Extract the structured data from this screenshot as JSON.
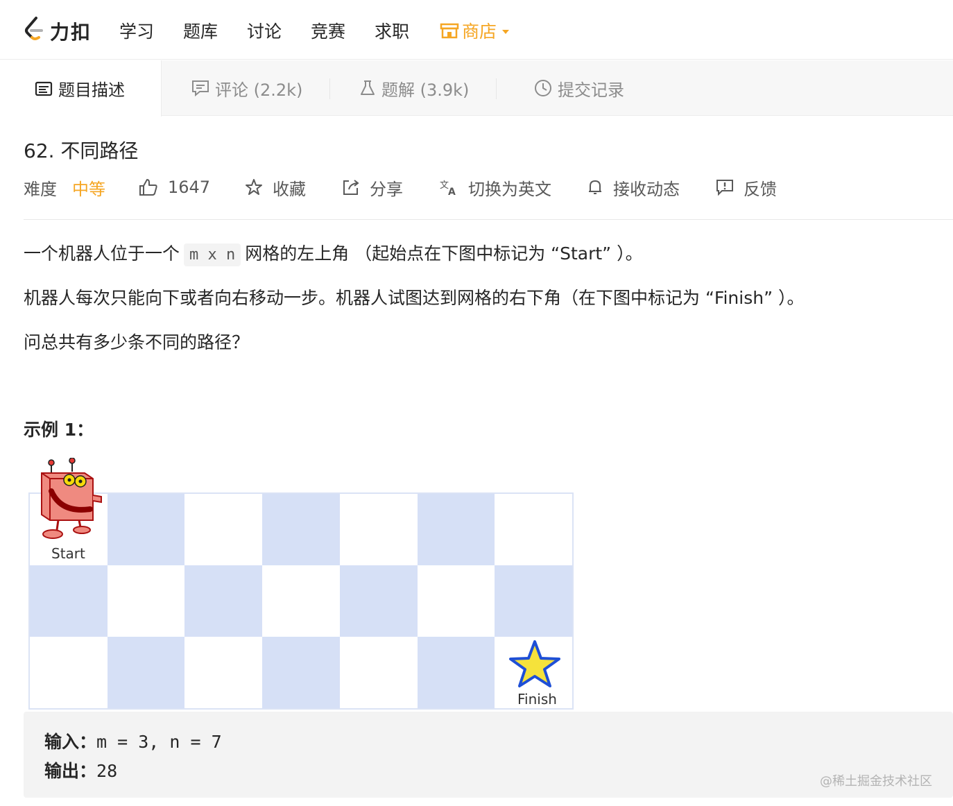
{
  "nav": {
    "logo_text": "力扣",
    "items": [
      "学习",
      "题库",
      "讨论",
      "竞赛",
      "求职"
    ],
    "store_label": "商店",
    "accent": "#f5a623"
  },
  "tabs": [
    {
      "label": "题目描述",
      "icon": "description-icon"
    },
    {
      "label": "评论 (2.2k)",
      "icon": "comment-icon"
    },
    {
      "label": "题解 (3.9k)",
      "icon": "flask-icon"
    },
    {
      "label": "提交记录",
      "icon": "clock-icon"
    }
  ],
  "problem": {
    "title": "62. 不同路径",
    "difficulty_label": "难度",
    "difficulty": "中等",
    "likes": "1647",
    "favorite": "收藏",
    "share": "分享",
    "translate": "切换为英文",
    "subscribe": "接收动态",
    "feedback": "反馈"
  },
  "description": {
    "p1_before": "一个机器人位于一个",
    "p1_code": "m x n",
    "p1_after": "网格的左上角 （起始点在下图中标记为 “Start” ）。",
    "p2": "机器人每次只能向下或者向右移动一步。机器人试图达到网格的右下角（在下图中标记为 “Finish” ）。",
    "p3": "问总共有多少条不同的路径？"
  },
  "example": {
    "title": "示例 1：",
    "start_label": "Start",
    "finish_label": "Finish",
    "grid_rows": 3,
    "grid_cols": 7,
    "input_label": "输入：",
    "input_value": "m = 3, n = 7",
    "output_label": "输出：",
    "output_value": "28"
  },
  "watermark": "@稀土掘金技术社区"
}
